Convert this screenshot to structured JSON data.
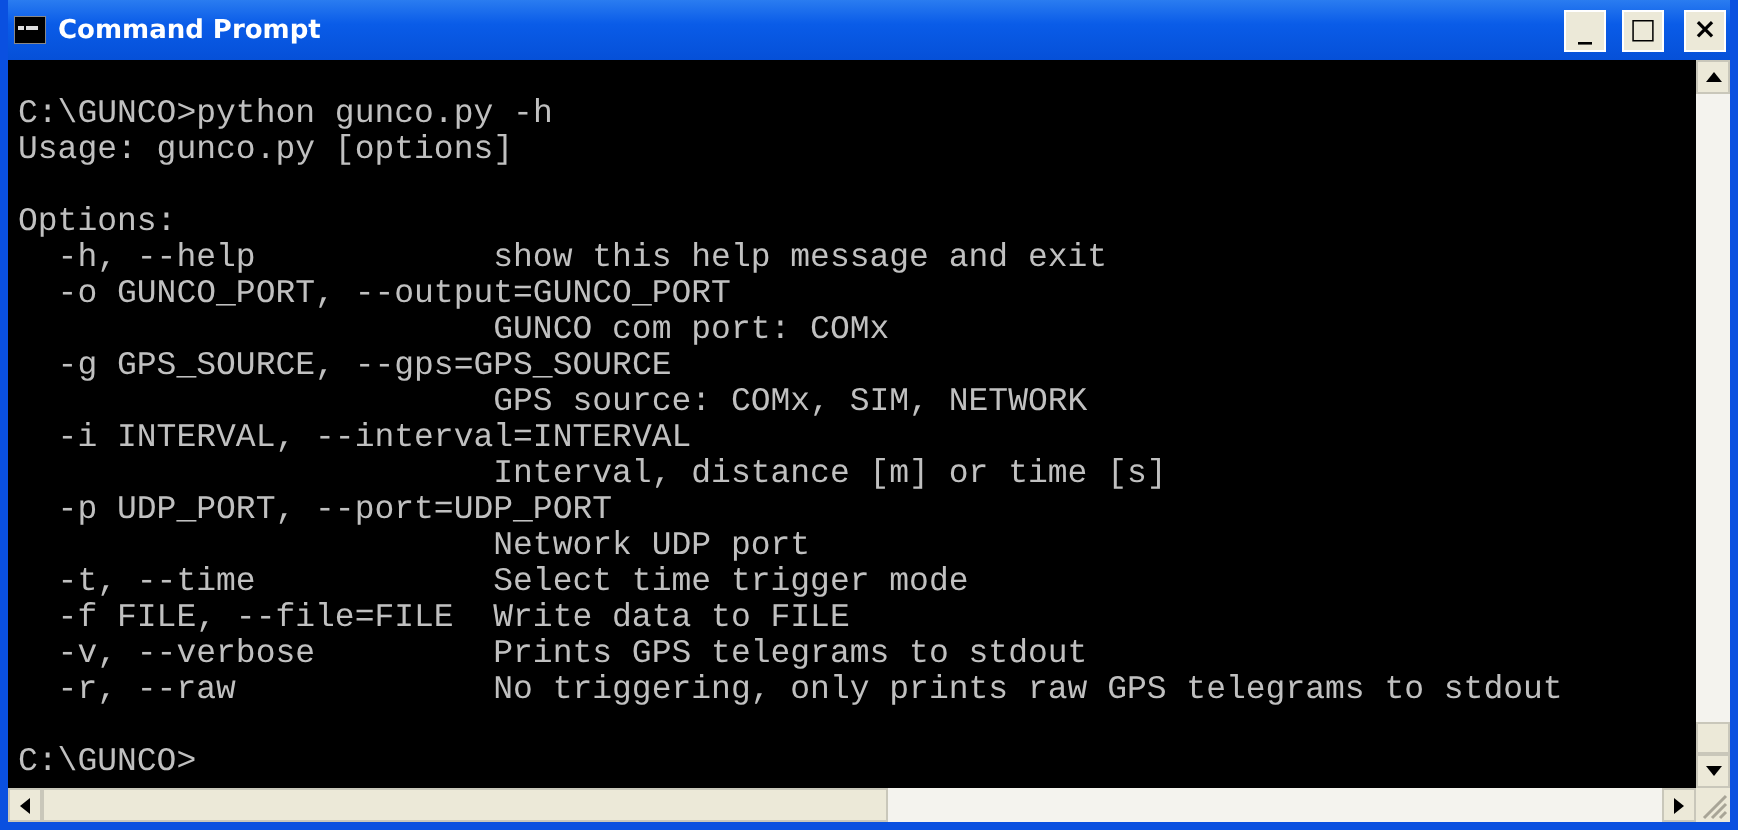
{
  "window": {
    "title": "Command Prompt",
    "controls": [
      "_",
      "□",
      "×"
    ]
  },
  "console": {
    "header": [
      {
        "text": "C:\\GUNCO>python gunco.py -h",
        "blank_before": true
      },
      {
        "text": "Usage: gunco.py [options]",
        "blank_before": false
      },
      {
        "text": "Options:",
        "blank_before": true
      }
    ],
    "options": [
      {
        "flags": "-h, --help",
        "description": "show this help message and exit",
        "wrapped": false
      },
      {
        "flags": "-o GUNCO_PORT, --output=GUNCO_PORT",
        "description": "GUNCO com port: COMx",
        "wrapped": true
      },
      {
        "flags": "-g GPS_SOURCE, --gps=GPS_SOURCE",
        "description": "GPS source: COMx, SIM, NETWORK",
        "wrapped": true
      },
      {
        "flags": "-i INTERVAL, --interval=INTERVAL",
        "description": "Interval, distance [m] or time [s]",
        "wrapped": true
      },
      {
        "flags": "-p UDP_PORT, --port=UDP_PORT",
        "description": "Network UDP port",
        "wrapped": true
      },
      {
        "flags": "-t, --time",
        "description": "Select time trigger mode",
        "wrapped": false
      },
      {
        "flags": "-f FILE, --file=FILE",
        "description": "Write data to FILE",
        "wrapped": false
      },
      {
        "flags": "-v, --verbose",
        "description": "Prints GPS telegrams to stdout",
        "wrapped": false
      },
      {
        "flags": "-r, --raw",
        "description": "No triggering, only prints raw GPS telegrams to stdout",
        "wrapped": false
      }
    ],
    "prompt": {
      "text": "C:\\GUNCO>",
      "blank_before": true
    }
  }
}
